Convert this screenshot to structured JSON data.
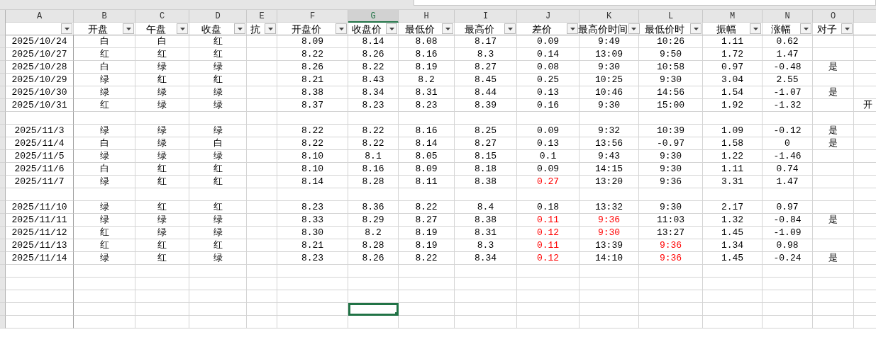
{
  "columns": [
    {
      "letter": "A",
      "selected": false
    },
    {
      "letter": "B",
      "selected": false
    },
    {
      "letter": "C",
      "selected": false
    },
    {
      "letter": "D",
      "selected": false
    },
    {
      "letter": "E",
      "selected": false
    },
    {
      "letter": "F",
      "selected": false
    },
    {
      "letter": "G",
      "selected": true
    },
    {
      "letter": "H",
      "selected": false
    },
    {
      "letter": "I",
      "selected": false
    },
    {
      "letter": "J",
      "selected": false
    },
    {
      "letter": "K",
      "selected": false
    },
    {
      "letter": "L",
      "selected": false
    },
    {
      "letter": "M",
      "selected": false
    },
    {
      "letter": "N",
      "selected": false
    },
    {
      "letter": "O",
      "selected": false
    }
  ],
  "headers": {
    "B": "开盘",
    "C": "午盘",
    "D": "收盘",
    "E": "抗",
    "F": "开盘价",
    "G": "收盘价",
    "H": "最低价",
    "I": "最高价",
    "J": "差价",
    "K": "最高价时间",
    "L": "最低价时",
    "M": "振幅",
    "N": "涨幅",
    "O": "对子"
  },
  "rows": [
    {
      "kind": "data",
      "cells": {
        "A": "2025/10/24",
        "B": "白",
        "C": "白",
        "D": "红",
        "F": "8.09",
        "G": "8.14",
        "H": "8.08",
        "I": "8.17",
        "J": "0.09",
        "K": "9:49",
        "L": "10:26",
        "M": "1.11",
        "N": "0.62"
      }
    },
    {
      "kind": "data",
      "cells": {
        "A": "2025/10/27",
        "B": "红",
        "C": "红",
        "D": "红",
        "F": "8.22",
        "G": "8.26",
        "H": "8.16",
        "I": "8.3",
        "J": "0.14",
        "K": "13:09",
        "L": "9:50",
        "M": "1.72",
        "N": "1.47"
      }
    },
    {
      "kind": "data",
      "cells": {
        "A": "2025/10/28",
        "B": "白",
        "C": "绿",
        "D": "绿",
        "F": "8.26",
        "G": "8.22",
        "H": "8.19",
        "I": "8.27",
        "J": "0.08",
        "K": "9:30",
        "L": "10:58",
        "M": "0.97",
        "N": "-0.48",
        "O": "是"
      }
    },
    {
      "kind": "data",
      "cells": {
        "A": "2025/10/29",
        "B": "绿",
        "C": "红",
        "D": "红",
        "F": "8.21",
        "G": "8.43",
        "H": "8.2",
        "I": "8.45",
        "J": "0.25",
        "K": "10:25",
        "L": "9:30",
        "M": "3.04",
        "N": "2.55"
      }
    },
    {
      "kind": "data",
      "cells": {
        "A": "2025/10/30",
        "B": "绿",
        "C": "绿",
        "D": "绿",
        "F": "8.38",
        "G": "8.34",
        "H": "8.31",
        "I": "8.44",
        "J": "0.13",
        "K": "10:46",
        "L": "14:56",
        "M": "1.54",
        "N": "-1.07",
        "O": "是"
      }
    },
    {
      "kind": "data",
      "cells": {
        "A": "2025/10/31",
        "B": "红",
        "C": "绿",
        "D": "绿",
        "F": "8.37",
        "G": "8.23",
        "H": "8.23",
        "I": "8.39",
        "J": "0.16",
        "K": "9:30",
        "L": "15:00",
        "M": "1.92",
        "N": "-1.32",
        "P": "开"
      }
    },
    {
      "kind": "blank"
    },
    {
      "kind": "data",
      "cells": {
        "A": "2025/11/3",
        "B": "绿",
        "C": "绿",
        "D": "绿",
        "F": "8.22",
        "G": "8.22",
        "H": "8.16",
        "I": "8.25",
        "J": "0.09",
        "K": "9:32",
        "L": "10:39",
        "M": "1.09",
        "N": "-0.12",
        "O": "是"
      }
    },
    {
      "kind": "data",
      "cells": {
        "A": "2025/11/4",
        "B": "白",
        "C": "绿",
        "D": "白",
        "F": "8.22",
        "G": "8.22",
        "H": "8.14",
        "I": "8.27",
        "J": "0.13",
        "K": "13:56",
        "L": "-0.97",
        "M": "1.58",
        "N": "0",
        "O": "是"
      }
    },
    {
      "kind": "data",
      "cells": {
        "A": "2025/11/5",
        "B": "绿",
        "C": "绿",
        "D": "绿",
        "F": "8.10",
        "G": "8.1",
        "H": "8.05",
        "I": "8.15",
        "J": "0.1",
        "K": "9:43",
        "L": "9:30",
        "M": "1.22",
        "N": "-1.46"
      }
    },
    {
      "kind": "data",
      "cells": {
        "A": "2025/11/6",
        "B": "白",
        "C": "红",
        "D": "红",
        "F": "8.10",
        "G": "8.16",
        "H": "8.09",
        "I": "8.18",
        "J": "0.09",
        "K": "14:15",
        "L": "9:30",
        "M": "1.11",
        "N": "0.74"
      }
    },
    {
      "kind": "data",
      "cells": {
        "A": "2025/11/7",
        "B": "绿",
        "C": "红",
        "D": "红",
        "F": "8.14",
        "G": "8.28",
        "H": "8.11",
        "I": "8.38",
        "J": {
          "text": "0.27",
          "color": "#ff0000"
        },
        "K": "13:20",
        "L": "9:36",
        "M": "3.31",
        "N": "1.47"
      }
    },
    {
      "kind": "blank"
    },
    {
      "kind": "data",
      "cells": {
        "A": "2025/11/10",
        "B": "绿",
        "C": "红",
        "D": "红",
        "F": "8.23",
        "G": "8.36",
        "H": "8.22",
        "I": "8.4",
        "J": "0.18",
        "K": "13:32",
        "L": "9:30",
        "M": "2.17",
        "N": "0.97"
      }
    },
    {
      "kind": "data",
      "cells": {
        "A": "2025/11/11",
        "B": "绿",
        "C": "绿",
        "D": "绿",
        "F": "8.33",
        "G": "8.29",
        "H": "8.27",
        "I": "8.38",
        "J": {
          "text": "0.11",
          "color": "#ff0000"
        },
        "K": {
          "text": "9:36",
          "color": "#ff0000"
        },
        "L": "11:03",
        "M": "1.32",
        "N": "-0.84",
        "O": "是"
      }
    },
    {
      "kind": "data",
      "cells": {
        "A": "2025/11/12",
        "B": "红",
        "C": "绿",
        "D": "绿",
        "F": "8.30",
        "G": "8.2",
        "H": "8.19",
        "I": "8.31",
        "J": {
          "text": "0.12",
          "color": "#ff0000"
        },
        "K": {
          "text": "9:30",
          "color": "#ff0000"
        },
        "L": "13:27",
        "M": "1.45",
        "N": "-1.09"
      }
    },
    {
      "kind": "data",
      "cells": {
        "A": "2025/11/13",
        "B": "红",
        "C": "红",
        "D": "红",
        "F": "8.21",
        "G": "8.28",
        "H": "8.19",
        "I": "8.3",
        "J": {
          "text": "0.11",
          "color": "#ff0000"
        },
        "K": "13:39",
        "L": {
          "text": "9:36",
          "color": "#ff0000"
        },
        "M": "1.34",
        "N": "0.98"
      }
    },
    {
      "kind": "data",
      "cells": {
        "A": "2025/11/14",
        "B": "绿",
        "C": "红",
        "D": "绿",
        "F": "8.23",
        "G": "8.26",
        "H": "8.22",
        "I": "8.34",
        "J": {
          "text": "0.12",
          "color": "#ff0000"
        },
        "K": "14:10",
        "L": {
          "text": "9:36",
          "color": "#ff0000"
        },
        "M": "1.45",
        "N": "-0.24",
        "O": "是"
      }
    },
    {
      "kind": "blank",
      "selected": false
    },
    {
      "kind": "blank",
      "selected": false
    },
    {
      "kind": "blank",
      "selected": false
    },
    {
      "kind": "blank",
      "selected": true
    },
    {
      "kind": "blank",
      "selected": false
    }
  ]
}
